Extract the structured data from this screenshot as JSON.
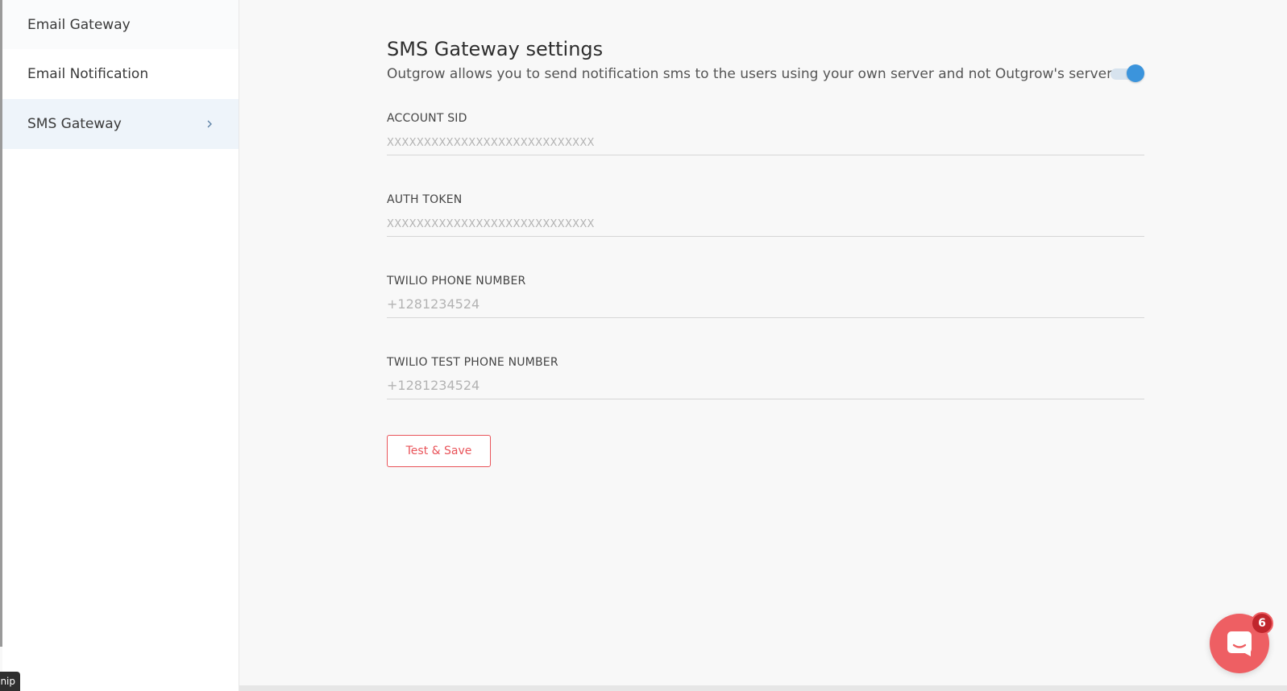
{
  "sidebar": {
    "items": [
      {
        "label": "Email Gateway"
      },
      {
        "label": "Email Notification"
      },
      {
        "label": "SMS Gateway"
      }
    ]
  },
  "main": {
    "title": "SMS Gateway settings",
    "description": "Outgrow allows you to send notification sms to the users using your own server and not Outgrow's server.",
    "toggle_enabled": true,
    "fields": [
      {
        "label": "ACCOUNT SID",
        "value": "",
        "placeholder": "XXXXXXXXXXXXXXXXXXXXXXXXXXXX"
      },
      {
        "label": "AUTH TOKEN",
        "value": "",
        "placeholder": "XXXXXXXXXXXXXXXXXXXXXXXXXXXX"
      },
      {
        "label": "TWILIO PHONE NUMBER",
        "value": "",
        "placeholder": "+1281234524"
      },
      {
        "label": "TWILIO TEST PHONE NUMBER",
        "value": "",
        "placeholder": "+1281234524"
      }
    ],
    "submit_label": "Test & Save"
  },
  "chat": {
    "badge_count": "6"
  },
  "tooltip": {
    "text": "nip"
  },
  "colors": {
    "accent_blue": "#3b94dc",
    "accent_red": "#e9545a",
    "chat_bg": "#ee5f63",
    "badge_bg": "#c0262c",
    "active_item_bg": "#eef4fa"
  }
}
